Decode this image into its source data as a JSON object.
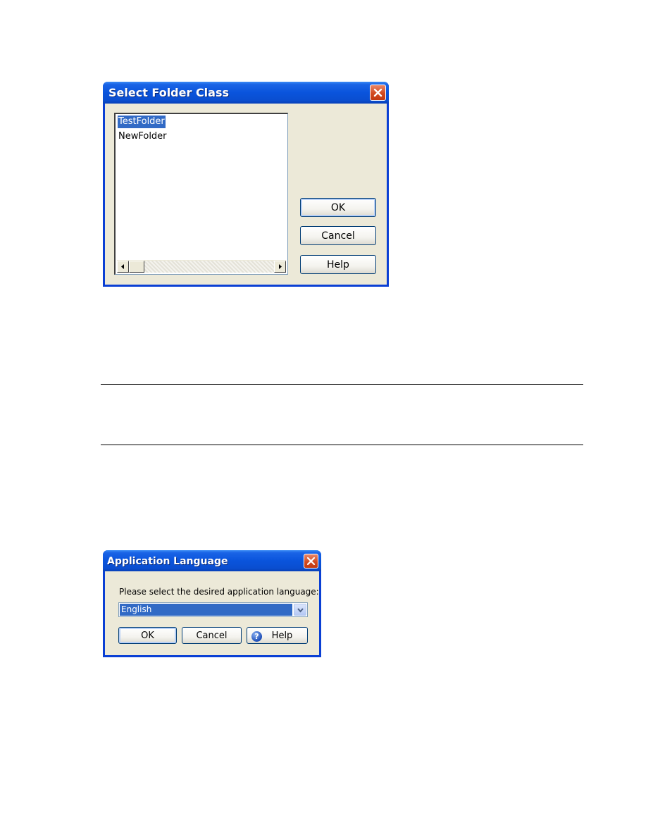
{
  "select_folder_dialog": {
    "title": "Select Folder Class",
    "items": [
      "TestFolder",
      "NewFolder"
    ],
    "selected_index": 0,
    "ok_label": "OK",
    "cancel_label": "Cancel",
    "help_label": "Help"
  },
  "language_dialog": {
    "title": "Application Language",
    "prompt": "Please select the desired application language:",
    "selected_language": "English",
    "ok_label": "OK",
    "cancel_label": "Cancel",
    "help_label": "Help"
  },
  "icons": {
    "close": "close-icon",
    "help": "help-icon",
    "dropdown": "chevron-down-icon",
    "scroll_left": "arrow-left-icon",
    "scroll_right": "arrow-right-icon"
  },
  "colors": {
    "titlebar": "#0a54dc",
    "selection": "#316ac5",
    "dialog_bg": "#ece9d8",
    "close_button": "#d24a20"
  }
}
